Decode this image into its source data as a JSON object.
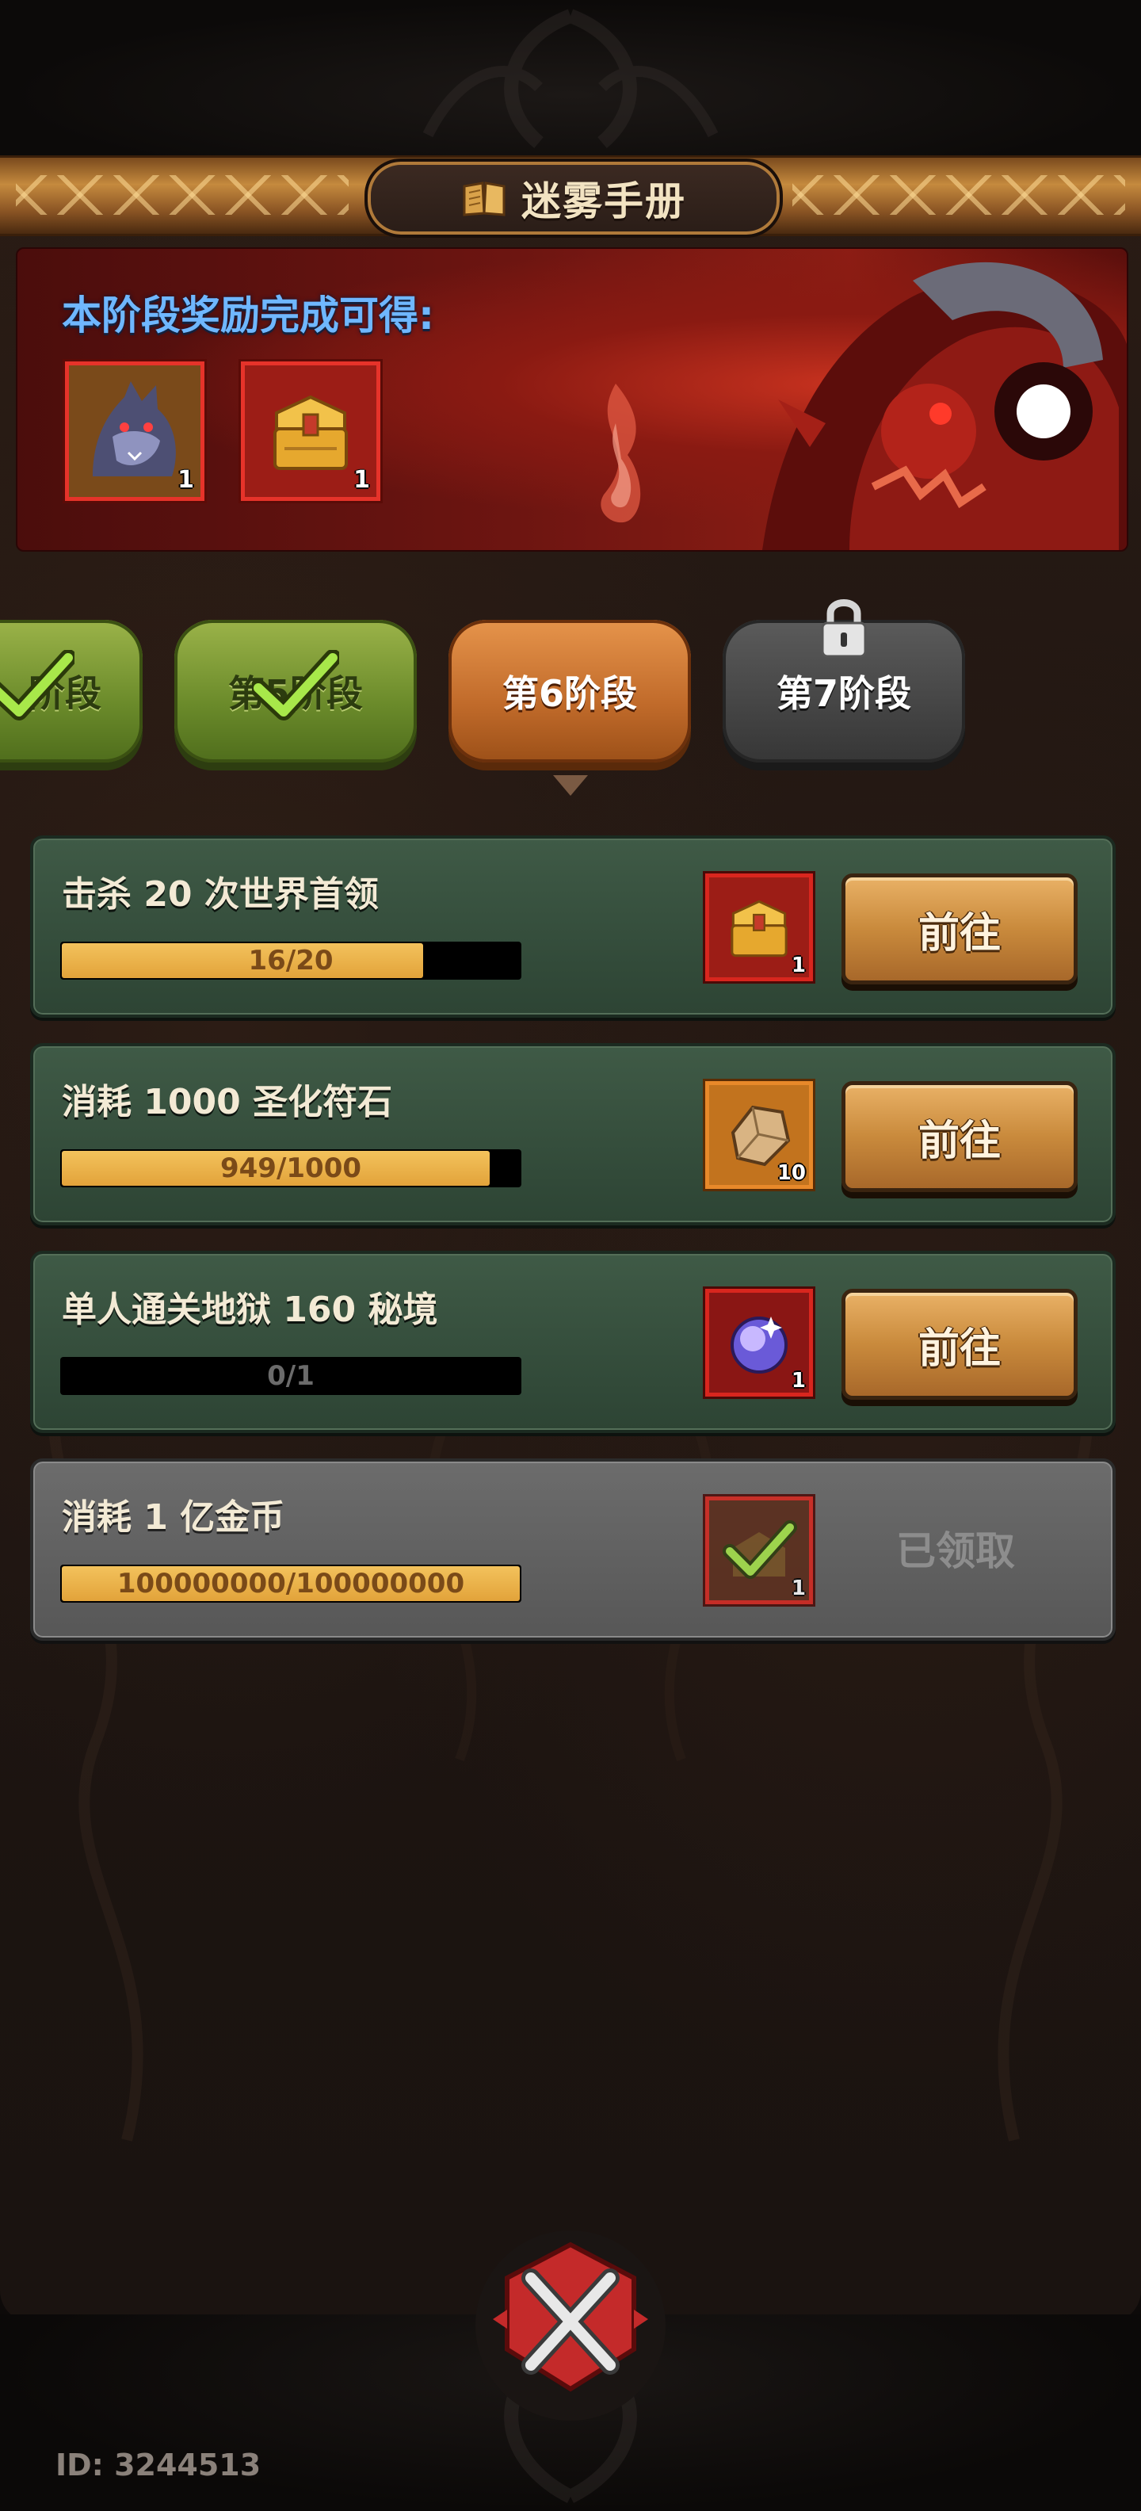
{
  "header": {
    "title": "迷雾手册",
    "icon": "book-icon"
  },
  "reward_banner": {
    "title": "本阶段奖励完成可得:",
    "rewards": [
      {
        "icon": "wolf-portrait-icon",
        "count": "1"
      },
      {
        "icon": "golden-chest-icon",
        "count": "1"
      }
    ]
  },
  "stage_tabs": [
    {
      "label": "阶段",
      "state": "completed",
      "icon": "checkmark-icon"
    },
    {
      "label": "第5阶段",
      "state": "completed",
      "icon": "checkmark-icon"
    },
    {
      "label": "第6阶段",
      "state": "active"
    },
    {
      "label": "第7阶段",
      "state": "locked",
      "icon": "padlock-icon"
    }
  ],
  "quests": [
    {
      "title": "击杀 20 次世界首领",
      "progress_text": "16/20",
      "progress": 0.8,
      "reward_icon": "golden-chest-icon",
      "reward_count": "1",
      "action": "前往",
      "state": "open"
    },
    {
      "title": "消耗 1000 圣化符石",
      "progress_text": "949/1000",
      "progress": 0.949,
      "reward_icon": "rune-stone-icon",
      "reward_count": "10",
      "action": "前往",
      "state": "open"
    },
    {
      "title": "单人通关地狱 160 秘境",
      "progress_text": "0/1",
      "progress": 0,
      "reward_icon": "crystal-orb-icon",
      "reward_count": "1",
      "action": "前往",
      "state": "open"
    },
    {
      "title": "消耗 1 亿金币",
      "progress_text": "100000000/100000000",
      "progress": 1,
      "reward_icon": "claimed-check-icon",
      "reward_count": "1",
      "action": "已领取",
      "state": "claimed"
    }
  ],
  "footer": {
    "user_id": "ID: 3244513",
    "close_icon": "close-x-icon"
  },
  "colors": {
    "banner_title": "#6fb7ff",
    "progress_fill": "#e2a33a",
    "tab_done": "#6a8a2a",
    "tab_active": "#c06a2a",
    "tab_locked": "#454545",
    "quest_bg": "#3f5a46"
  }
}
